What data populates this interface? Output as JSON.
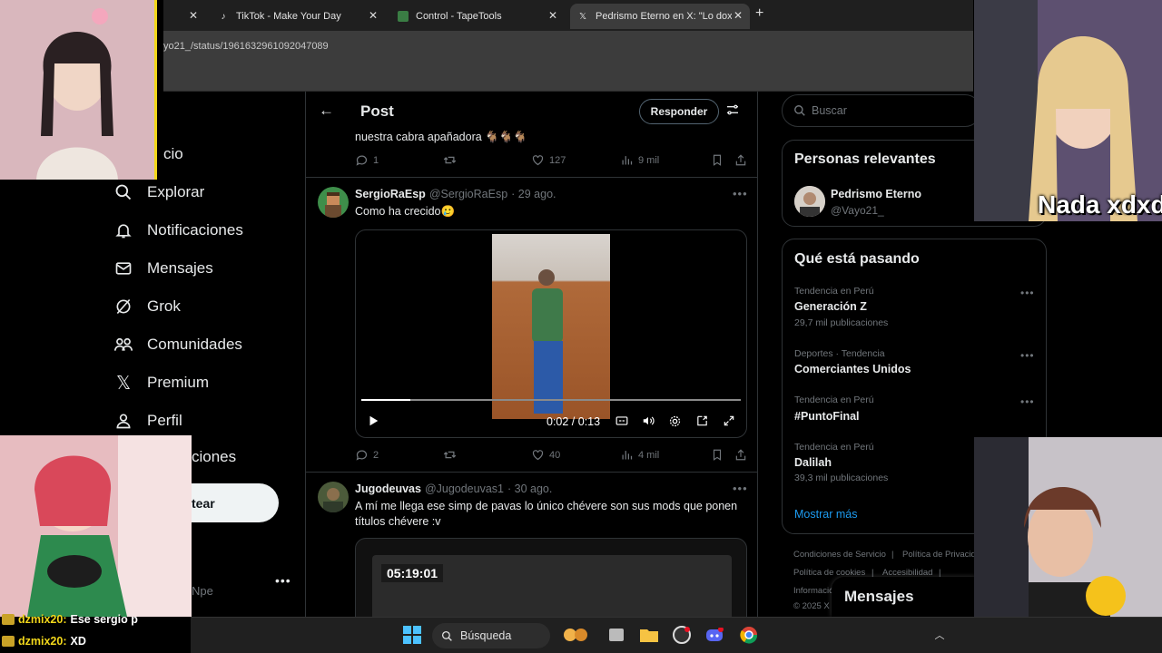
{
  "browser": {
    "tabs": [
      {
        "label": "TikTok - Make Your Day",
        "icon": "tiktok-icon"
      },
      {
        "label": "Control - TapeTools",
        "icon": "tapetools-icon"
      },
      {
        "label": "Pedrismo Eterno en X: \"Lo doxe",
        "icon": "x-logo-icon"
      }
    ],
    "url": "yo21_/status/1961632961092047089"
  },
  "nav": {
    "items": [
      {
        "label": "cio",
        "icon": "home-icon"
      },
      {
        "label": "Explorar",
        "icon": "search-icon"
      },
      {
        "label": "Notificaciones",
        "icon": "bell-icon"
      },
      {
        "label": "Mensajes",
        "icon": "mail-icon"
      },
      {
        "label": "Grok",
        "icon": "grok-icon"
      },
      {
        "label": "Comunidades",
        "icon": "people-icon"
      },
      {
        "label": "Premium",
        "icon": "x-logo-icon"
      },
      {
        "label": "Perfil",
        "icon": "person-icon"
      },
      {
        "label": "ciones",
        "icon": "more-icon"
      }
    ],
    "post_button": "tear",
    "account_handle": "Npe"
  },
  "main": {
    "title": "Post",
    "reply_button": "Responder",
    "tweets": [
      {
        "text": "nuestra cabra apañadora 🐐🐐🐐",
        "replies": "1",
        "retweets": "",
        "likes": "127",
        "views": "9 mil"
      },
      {
        "name": "SergioRaEsp",
        "handle": "@SergioRaEsp",
        "time": "· 29 ago.",
        "text": "Como ha crecido🥲",
        "replies": "2",
        "retweets": "",
        "likes": "40",
        "views": "4 mil",
        "video": {
          "time": "0:02 / 0:13",
          "progress": 0.13
        }
      },
      {
        "name": "Jugodeuvas",
        "handle": "@Jugodeuvas1",
        "time": "· 30 ago.",
        "text": "A mí me llega ese simp de pavas lo único chévere son sus mods que ponen títulos chévere :v",
        "video": {
          "time": "05:19:01"
        }
      }
    ]
  },
  "sidebar": {
    "search_placeholder": "Buscar",
    "relevant": {
      "title": "Personas relevantes",
      "name": "Pedrismo Eterno",
      "handle": "@Vayo21_"
    },
    "trends": {
      "title": "Qué está pasando",
      "items": [
        {
          "context": "Tendencia en Perú",
          "name": "Generación Z",
          "count": "29,7 mil publicaciones"
        },
        {
          "context": "Deportes · Tendencia",
          "name": "Comerciantes Unidos",
          "count": ""
        },
        {
          "context": "Tendencia en Perú",
          "name": "#PuntoFinal",
          "count": ""
        },
        {
          "context": "Tendencia en Perú",
          "name": "Dalilah",
          "count": "39,3 mil publicaciones"
        }
      ],
      "show_more": "Mostrar más"
    },
    "footer": {
      "links": [
        "Condiciones de Servicio",
        "|",
        "Política de Privacid",
        "Política de cookies",
        "|",
        "Accesibilidad",
        "|",
        "Informació",
        "© 2025 X"
      ]
    }
  },
  "dm_drawer": {
    "label": "Mensajes"
  },
  "overlay": {
    "caption": "Nada xdxd",
    "chat": [
      {
        "user": "dzmix20:",
        "message": "Ese sergio p"
      },
      {
        "user": "dzmix20:",
        "message": "XD"
      }
    ]
  },
  "taskbar": {
    "search_label": "Búsqueda"
  },
  "colors": {
    "accent": "#1d9bf0",
    "background": "#000000",
    "border": "#2f3336",
    "muted": "#71767b"
  }
}
